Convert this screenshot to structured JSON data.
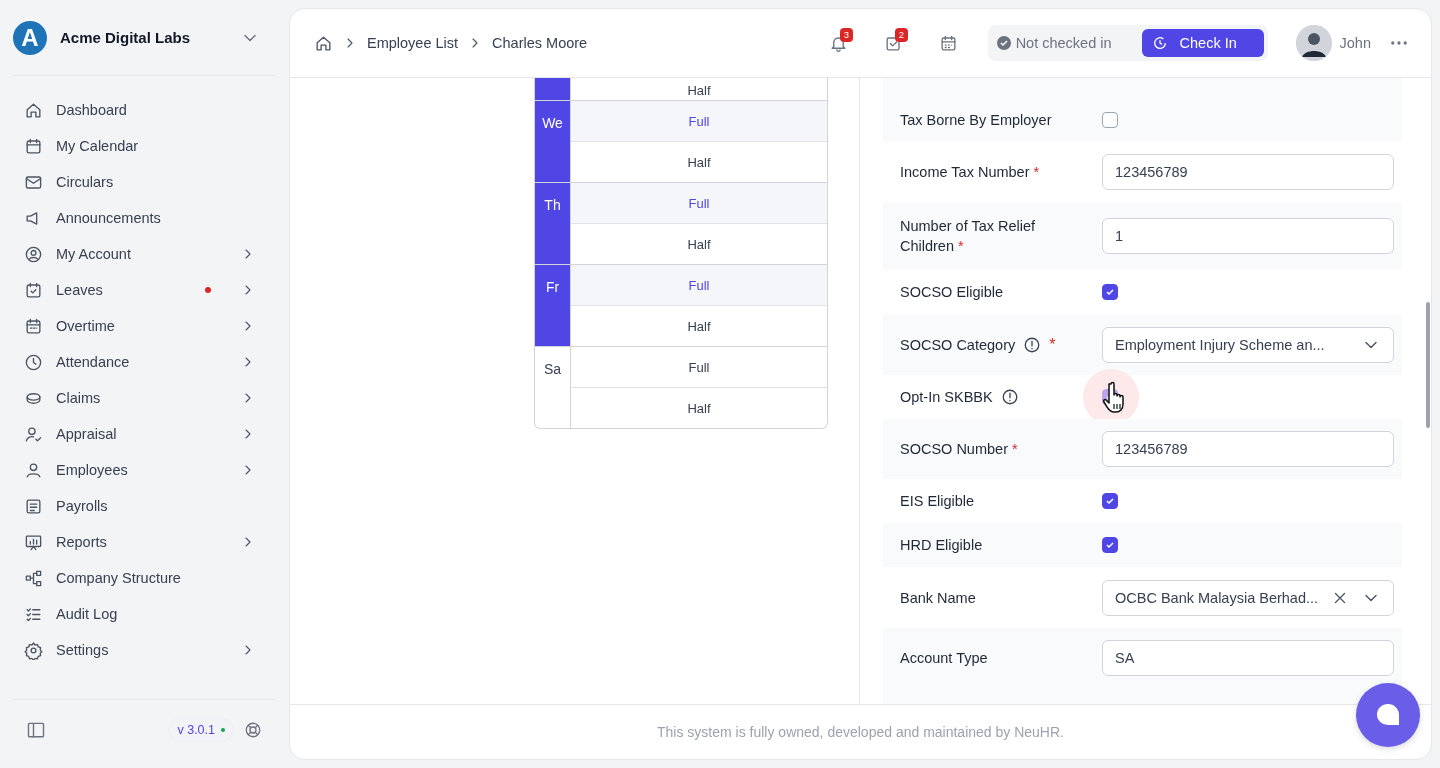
{
  "sidebar": {
    "logo_letter": "A",
    "company": "Acme Digital Labs",
    "items": [
      {
        "label": "Dashboard",
        "expandable": false,
        "dot": false
      },
      {
        "label": "My Calendar",
        "expandable": false,
        "dot": false
      },
      {
        "label": "Circulars",
        "expandable": false,
        "dot": false
      },
      {
        "label": "Announcements",
        "expandable": false,
        "dot": false
      },
      {
        "label": "My Account",
        "expandable": true,
        "dot": false
      },
      {
        "label": "Leaves",
        "expandable": true,
        "dot": true
      },
      {
        "label": "Overtime",
        "expandable": true,
        "dot": false
      },
      {
        "label": "Attendance",
        "expandable": true,
        "dot": false
      },
      {
        "label": "Claims",
        "expandable": true,
        "dot": false
      },
      {
        "label": "Appraisal",
        "expandable": true,
        "dot": false
      },
      {
        "label": "Employees",
        "expandable": true,
        "dot": false
      },
      {
        "label": "Payrolls",
        "expandable": false,
        "dot": false
      },
      {
        "label": "Reports",
        "expandable": true,
        "dot": false
      },
      {
        "label": "Company Structure",
        "expandable": false,
        "dot": false
      },
      {
        "label": "Audit Log",
        "expandable": false,
        "dot": false
      },
      {
        "label": "Settings",
        "expandable": true,
        "dot": false
      }
    ],
    "version": "v 3.0.1"
  },
  "header": {
    "breadcrumb": [
      "Employee List",
      "Charles Moore"
    ],
    "notifications": "3",
    "tasks": "2",
    "status": "Not checked in",
    "check_in": "Check In",
    "user": "John"
  },
  "schedule": [
    {
      "day": "We",
      "highlighted": true,
      "options": [
        {
          "label": "Full",
          "selected": true
        },
        {
          "label": "Half",
          "selected": false
        }
      ]
    },
    {
      "day": "Th",
      "highlighted": true,
      "options": [
        {
          "label": "Full",
          "selected": true
        },
        {
          "label": "Half",
          "selected": false
        }
      ]
    },
    {
      "day": "Fr",
      "highlighted": true,
      "options": [
        {
          "label": "Full",
          "selected": true
        },
        {
          "label": "Half",
          "selected": false
        }
      ]
    },
    {
      "day": "Sa",
      "highlighted": false,
      "options": [
        {
          "label": "Full",
          "selected": false
        },
        {
          "label": "Half",
          "selected": false
        }
      ]
    }
  ],
  "schedule_top_option": "Half",
  "form": [
    {
      "kind": "checkbox",
      "label": "Tax Borne By Employer",
      "info": false,
      "checked": false,
      "focused": false
    },
    {
      "kind": "text",
      "label": "Income Tax Number",
      "required_mark": "*",
      "info": false,
      "value": "123456789"
    },
    {
      "kind": "text",
      "label": "Number of Tax Relief Children",
      "required_mark": "*",
      "info": false,
      "value": "1"
    },
    {
      "kind": "checkbox",
      "label": "SOCSO Eligible",
      "info": false,
      "checked": true,
      "focused": false
    },
    {
      "kind": "select",
      "label": "SOCSO Category",
      "required_mark": "*",
      "info": true,
      "value": "Employment Injury Scheme an...",
      "clearable": false
    },
    {
      "kind": "checkbox",
      "label": "Opt-In SKBBK",
      "info": true,
      "checked": true,
      "focused": true
    },
    {
      "kind": "text",
      "label": "SOCSO Number",
      "required_mark": "*",
      "info": false,
      "value": "123456789"
    },
    {
      "kind": "checkbox",
      "label": "EIS Eligible",
      "info": false,
      "checked": true,
      "focused": false
    },
    {
      "kind": "checkbox",
      "label": "HRD Eligible",
      "info": false,
      "checked": true,
      "focused": false
    },
    {
      "kind": "select",
      "label": "Bank Name",
      "info": false,
      "value": "OCBC Bank Malaysia Berhad...",
      "clearable": true
    },
    {
      "kind": "text",
      "label": "Account Type",
      "info": false,
      "value": "SA"
    }
  ],
  "footer": "This system is fully owned, developed and maintained by NeuHR."
}
